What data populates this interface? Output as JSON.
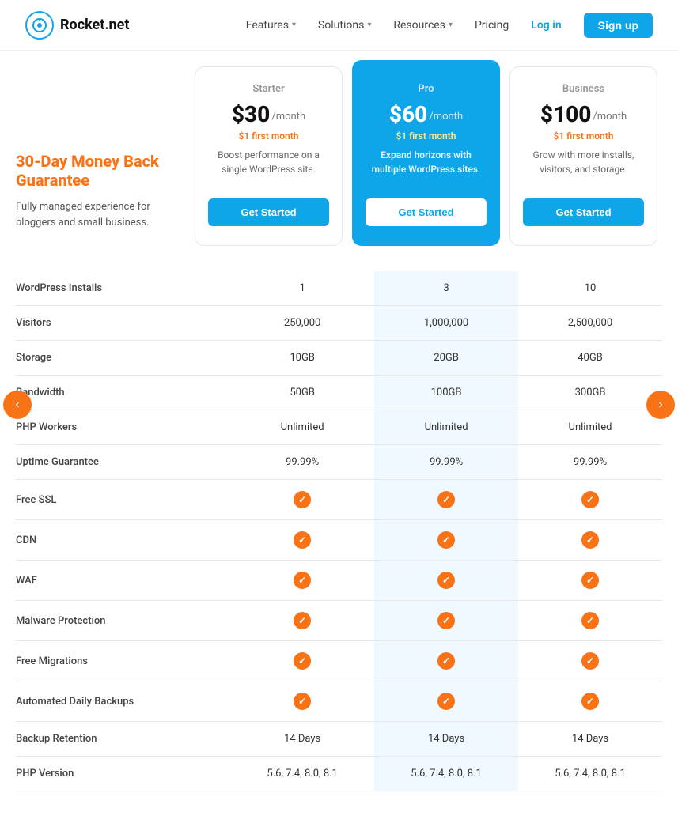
{
  "nav": {
    "logo_text": "Rocket.net",
    "links": [
      {
        "label": "Features",
        "has_dropdown": true
      },
      {
        "label": "Solutions",
        "has_dropdown": true
      },
      {
        "label": "Resources",
        "has_dropdown": true
      },
      {
        "label": "Pricing",
        "has_dropdown": false
      }
    ],
    "login_label": "Log in",
    "signup_label": "Sign up"
  },
  "sidebar": {
    "arrow_left": "‹",
    "arrow_right": "›"
  },
  "guarantee": {
    "title": "30-Day Money Back Guarantee",
    "desc": "Fully managed experience for bloggers and small business."
  },
  "plans": [
    {
      "name": "Starter",
      "price": "$30",
      "period": "/month",
      "first_month": "$1 first month",
      "desc": "Boost performance on a single WordPress site.",
      "cta": "Get Started",
      "featured": false
    },
    {
      "name": "Pro",
      "price": "$60",
      "period": "/month",
      "first_month": "$1 first month",
      "desc": "Expand horizons with multiple WordPress sites.",
      "cta": "Get Started",
      "featured": true
    },
    {
      "name": "Business",
      "price": "$100",
      "period": "/month",
      "first_month": "$1 first month",
      "desc": "Grow with more installs, visitors, and storage.",
      "cta": "Get Started",
      "featured": false
    }
  ],
  "features": [
    {
      "label": "WordPress Installs",
      "values": [
        "1",
        "3",
        "10"
      ],
      "type": "text"
    },
    {
      "label": "Visitors",
      "values": [
        "250,000",
        "1,000,000",
        "2,500,000"
      ],
      "type": "text"
    },
    {
      "label": "Storage",
      "values": [
        "10GB",
        "20GB",
        "40GB"
      ],
      "type": "text"
    },
    {
      "label": "Bandwidth",
      "values": [
        "50GB",
        "100GB",
        "300GB"
      ],
      "type": "text"
    },
    {
      "label": "PHP Workers",
      "values": [
        "Unlimited",
        "Unlimited",
        "Unlimited"
      ],
      "type": "text"
    },
    {
      "label": "Uptime Guarantee",
      "values": [
        "99.99%",
        "99.99%",
        "99.99%"
      ],
      "type": "text"
    },
    {
      "label": "Free SSL",
      "values": [
        true,
        true,
        true
      ],
      "type": "check"
    },
    {
      "label": "CDN",
      "values": [
        true,
        true,
        true
      ],
      "type": "check"
    },
    {
      "label": "WAF",
      "values": [
        true,
        true,
        true
      ],
      "type": "check"
    },
    {
      "label": "Malware Protection",
      "values": [
        true,
        true,
        true
      ],
      "type": "check"
    },
    {
      "label": "Free Migrations",
      "values": [
        true,
        true,
        true
      ],
      "type": "check"
    },
    {
      "label": "Automated Daily Backups",
      "values": [
        true,
        true,
        true
      ],
      "type": "check"
    },
    {
      "label": "Backup Retention",
      "values": [
        "14 Days",
        "14 Days",
        "14 Days"
      ],
      "type": "text"
    },
    {
      "label": "PHP Version",
      "values": [
        "5.6, 7.4, 8.0, 8.1",
        "5.6, 7.4, 8.0, 8.1",
        "5.6, 7.4, 8.0, 8.1"
      ],
      "type": "text"
    }
  ]
}
